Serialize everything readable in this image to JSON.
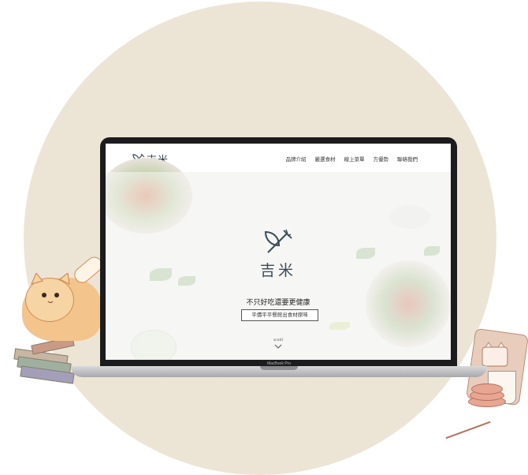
{
  "site": {
    "logo_text": "吉米",
    "nav": [
      "品牌介紹",
      "嚴選食材",
      "線上菜單",
      "方優勢",
      "聯絡我們"
    ],
    "hero_logo_text": "吉米",
    "slogan": "不只好吃還要更健康",
    "tagline": "平價平平餐館出食材原味",
    "scroll_label": "scroll"
  },
  "device": {
    "brand_label": "MacBook Pro"
  },
  "colors": {
    "background_circle": "#ece5d6",
    "logo_navy": "#35424f",
    "laptop_bezel": "#1c1c1e"
  },
  "icons": [
    "spoon-fork-leaf-logo",
    "chevron-down-icon"
  ]
}
